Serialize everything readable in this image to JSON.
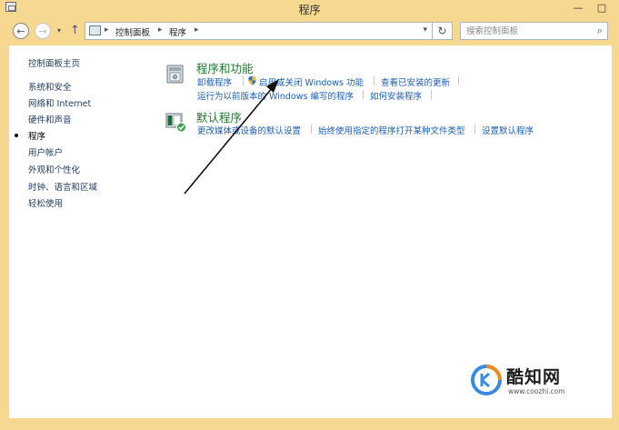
{
  "window": {
    "title": "程序",
    "minimize": "—",
    "maximize": "□"
  },
  "nav": {
    "back": "←",
    "forward": "→",
    "recent": "▾",
    "up": "↑",
    "breadcrumbs": [
      "控制面板",
      "程序"
    ],
    "refresh": "↻"
  },
  "search": {
    "placeholder": "搜索控制面板"
  },
  "sidebar": {
    "items": [
      {
        "label": "控制面板主页"
      },
      {
        "label": "系统和安全"
      },
      {
        "label": "网络和 Internet"
      },
      {
        "label": "硬件和声音"
      },
      {
        "label": "程序",
        "current": true
      },
      {
        "label": "用户帐户"
      },
      {
        "label": "外观和个性化"
      },
      {
        "label": "时钟、语言和区域"
      },
      {
        "label": "轻松使用"
      }
    ]
  },
  "categories": [
    {
      "title": "程序和功能",
      "links_row1": [
        "卸载程序",
        "启用或关闭 Windows 功能",
        "查看已安装的更新"
      ],
      "links_row2": [
        "运行为以前版本的 Windows 编写的程序",
        "如何安装程序"
      ]
    },
    {
      "title": "默认程序",
      "links_row1": [
        "更改媒体或设备的默认设置",
        "始终使用指定的程序打开某种文件类型",
        "设置默认程序"
      ]
    }
  ],
  "watermark": {
    "brand": "酷知网",
    "url": "www.coozhi.com"
  },
  "colors": {
    "frame": "#f6d890",
    "link": "#1a5fb4",
    "category_title": "#1c7a2c",
    "sidebar_text": "#1e395b"
  }
}
